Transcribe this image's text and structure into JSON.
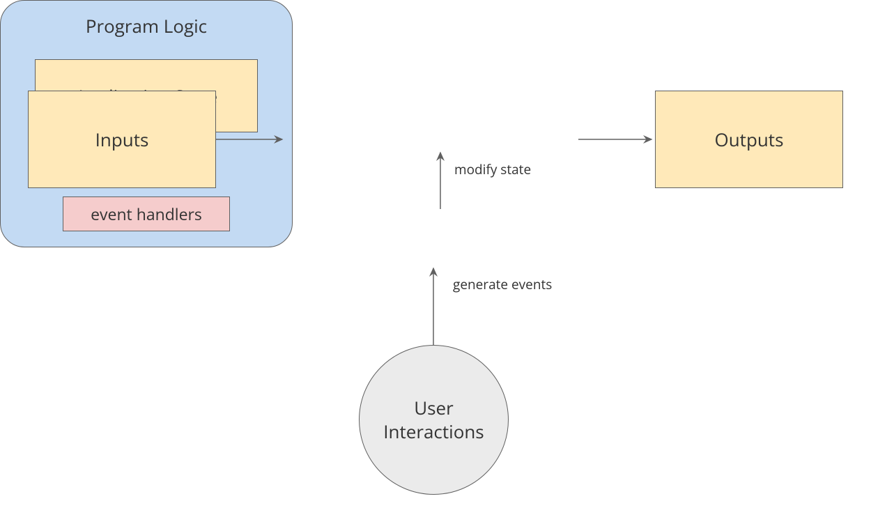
{
  "nodes": {
    "inputs": "Inputs",
    "outputs": "Outputs",
    "program_logic": "Program Logic",
    "application_state": "Application State",
    "event_handlers": "event handlers",
    "user_interactions_line1": "User",
    "user_interactions_line2": "Interactions"
  },
  "edges": {
    "modify_state": "modify state",
    "generate_events": "generate events"
  },
  "colors": {
    "yellow_fill": "#ffe9b9",
    "blue_fill": "#c3daf3",
    "pink_fill": "#f5cccc",
    "grey_fill": "#ebebeb",
    "border": "#606060"
  }
}
